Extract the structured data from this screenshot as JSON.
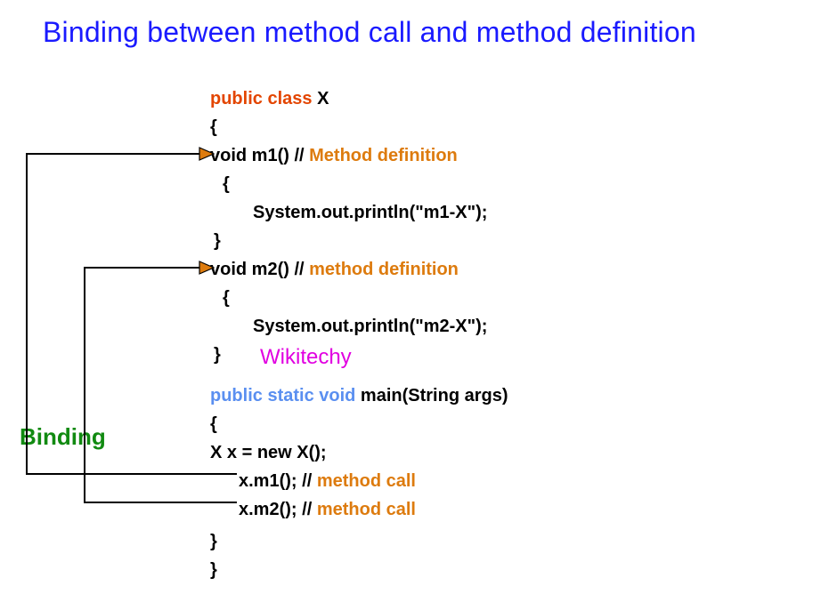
{
  "title": "Binding between method call and method definition",
  "bindingLabel": "Binding",
  "watermark": "Wikitechy",
  "code": {
    "publicClass": "public class",
    "className": "X",
    "lbrace": "{",
    "rbrace": "}",
    "voidM1Sig": "void m1()",
    "commentSep": " // ",
    "methodDefCap": "Method definition",
    "methodDefLow": "method definition",
    "printM1": "System.out.println(\"m1-X\");",
    "voidM2Sig": "void m2()",
    "printM2": "System.out.println(\"m2-X\");",
    "publicStaticVoid": "public static void",
    "mainSig": " main(String args)",
    "newX": "X x = new X();",
    "callM1": "x.m1();",
    "callM2": "x.m2();",
    "methodCall": "method call"
  }
}
